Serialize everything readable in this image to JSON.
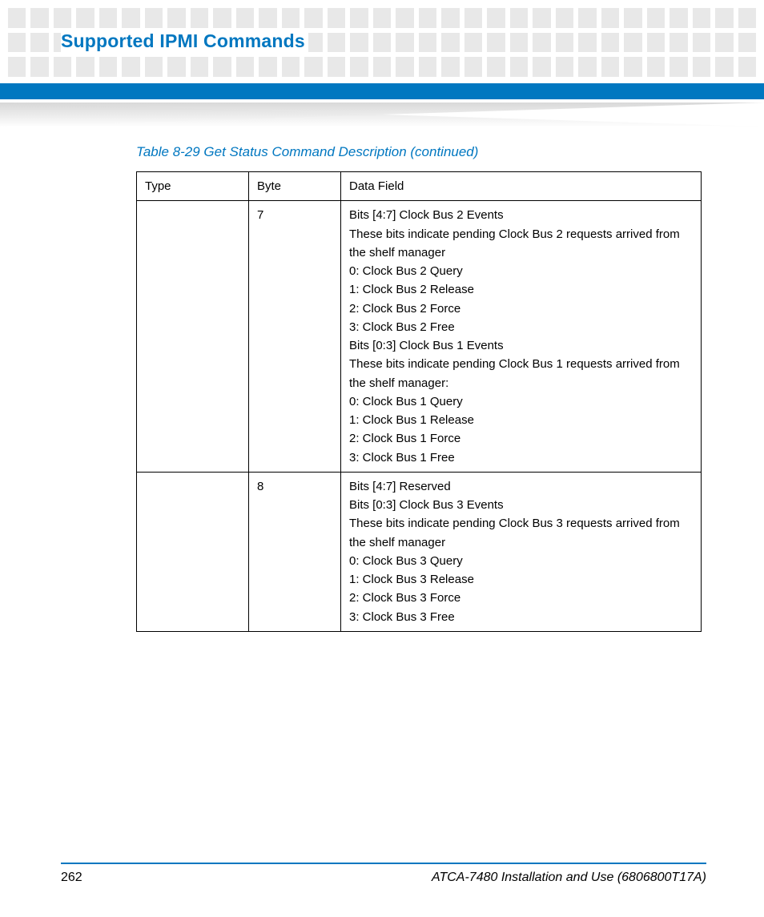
{
  "header": {
    "section_title": "Supported IPMI Commands"
  },
  "table": {
    "caption": "Table 8-29 Get Status Command Description (continued)",
    "headers": {
      "type": "Type",
      "byte": "Byte",
      "data": "Data Field"
    },
    "rows": [
      {
        "type": "",
        "byte": "7",
        "data": [
          "Bits [4:7] Clock Bus 2 Events",
          "These bits indicate pending Clock Bus 2 requests arrived from the shelf manager",
          "0: Clock Bus 2 Query",
          "1: Clock Bus 2 Release",
          "2: Clock Bus 2 Force",
          "3: Clock Bus 2 Free",
          "Bits [0:3] Clock Bus 1 Events",
          "These bits indicate pending Clock Bus 1 requests arrived from the shelf manager:",
          "0: Clock Bus 1 Query",
          "1: Clock Bus 1 Release",
          "2: Clock Bus 1 Force",
          "3: Clock Bus 1 Free"
        ]
      },
      {
        "type": "",
        "byte": "8",
        "data": [
          "Bits [4:7] Reserved",
          "Bits [0:3] Clock Bus 3 Events",
          "These bits indicate pending Clock Bus 3 requests arrived from the shelf manager",
          "0: Clock Bus 3 Query",
          "1: Clock Bus 3 Release",
          "2: Clock Bus 3 Force",
          "3: Clock Bus 3 Free"
        ]
      }
    ]
  },
  "footer": {
    "page_number": "262",
    "doc_title": "ATCA-7480 Installation and Use (6806800T17A)"
  }
}
